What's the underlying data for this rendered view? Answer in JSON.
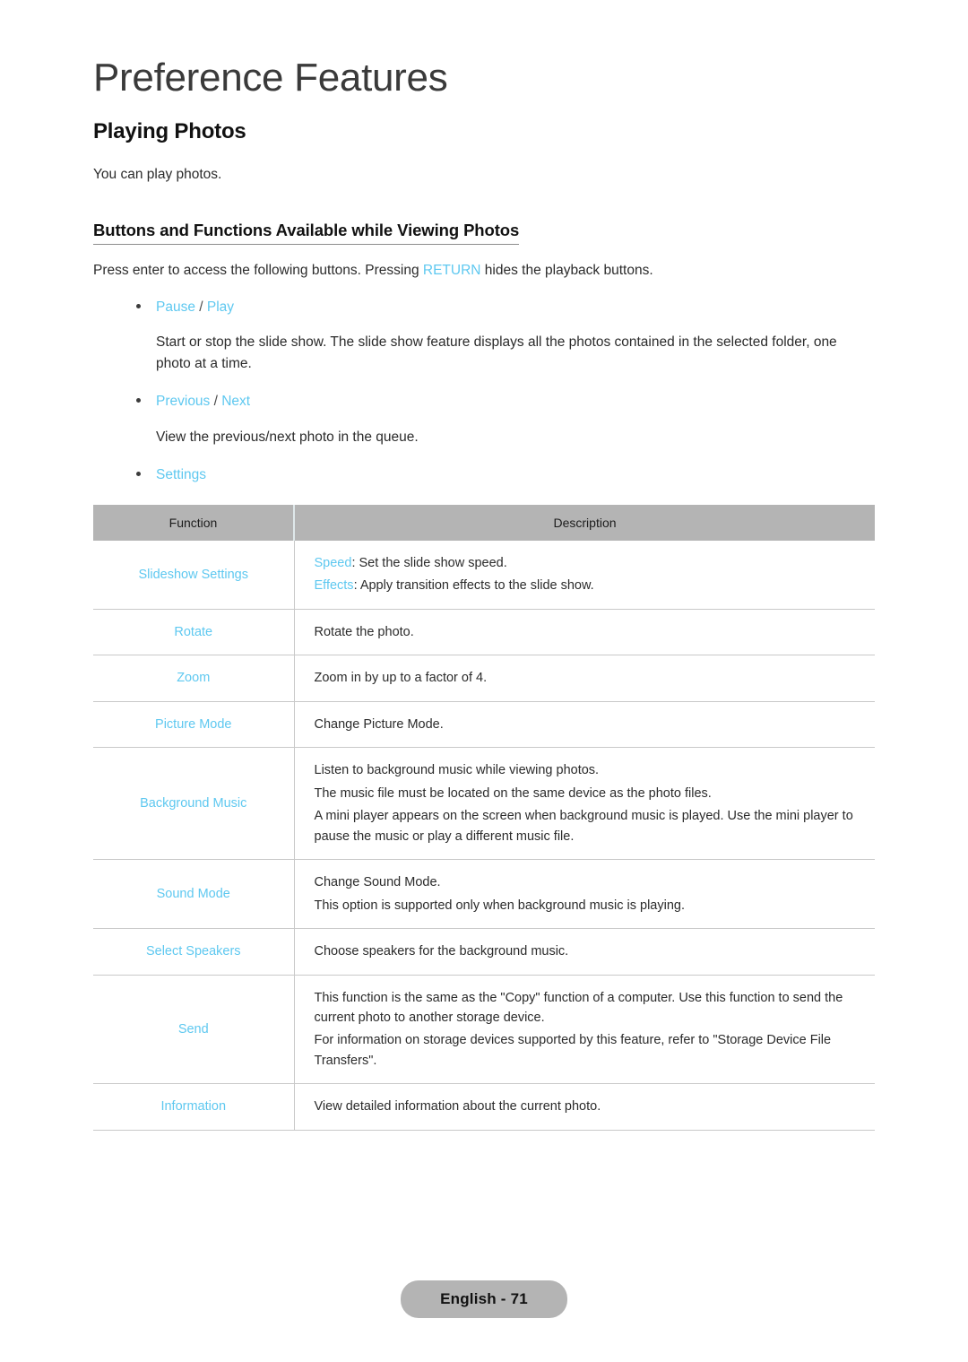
{
  "document": {
    "chapter_title": "Preference Features",
    "section_heading": "Playing Photos",
    "section_intro": "You can play photos.",
    "sub_heading": "Buttons and Functions Available while Viewing Photos",
    "intro_paragraph": {
      "before": "Press enter to access the following buttons. Pressing ",
      "accent": "RETURN",
      "after": " hides the playback buttons."
    }
  },
  "accent_color": "#5ec8f0",
  "header_bg_color": "#b4b4b4",
  "bullets": [
    {
      "label_a": "Pause",
      "separator": " / ",
      "label_b": "Play",
      "description": "Start or stop the slide show. The slide show feature displays all the photos contained in the selected folder, one photo at a time."
    },
    {
      "label_a": "Previous",
      "separator": " / ",
      "label_b": "Next",
      "description": "View the previous/next photo in the queue."
    },
    {
      "label_a": "Settings",
      "separator": "",
      "label_b": "",
      "description": ""
    }
  ],
  "table": {
    "columns": [
      "Function",
      "Description"
    ],
    "rows": [
      {
        "function": "Slideshow Settings",
        "lines": [
          {
            "accent": "Speed",
            "text": ": Set the slide show speed."
          },
          {
            "accent": "Effects",
            "text": ": Apply transition effects to the slide show."
          }
        ]
      },
      {
        "function": "Rotate",
        "lines": [
          {
            "accent": "",
            "text": "Rotate the photo."
          }
        ]
      },
      {
        "function": "Zoom",
        "lines": [
          {
            "accent": "",
            "text": "Zoom in by up to a factor of 4."
          }
        ]
      },
      {
        "function": "Picture Mode",
        "lines": [
          {
            "accent": "",
            "text": "Change Picture Mode."
          }
        ]
      },
      {
        "function": "Background Music",
        "lines": [
          {
            "accent": "",
            "text": "Listen to background music while viewing photos."
          },
          {
            "accent": "",
            "text": "The music file must be located on the same device as the photo files."
          },
          {
            "accent": "",
            "text": "A mini player appears on the screen when background music is played. Use the mini player to pause the music or play a different music file."
          }
        ]
      },
      {
        "function": "Sound Mode",
        "lines": [
          {
            "accent": "",
            "text": "Change Sound Mode."
          },
          {
            "accent": "",
            "text": "This option is supported only when background music is playing."
          }
        ]
      },
      {
        "function": "Select Speakers",
        "lines": [
          {
            "accent": "",
            "text": "Choose speakers for the background music."
          }
        ]
      },
      {
        "function": "Send",
        "lines": [
          {
            "accent": "",
            "text": "This function is the same as the \"Copy\" function of a computer. Use this function to send the current photo to another storage device."
          },
          {
            "accent": "",
            "text": "For information on storage devices supported by this feature, refer to \"Storage Device File Transfers\"."
          }
        ]
      },
      {
        "function": "Information",
        "lines": [
          {
            "accent": "",
            "text": "View detailed information about the current photo."
          }
        ]
      }
    ]
  },
  "footer": {
    "page_label": "English - 71"
  }
}
